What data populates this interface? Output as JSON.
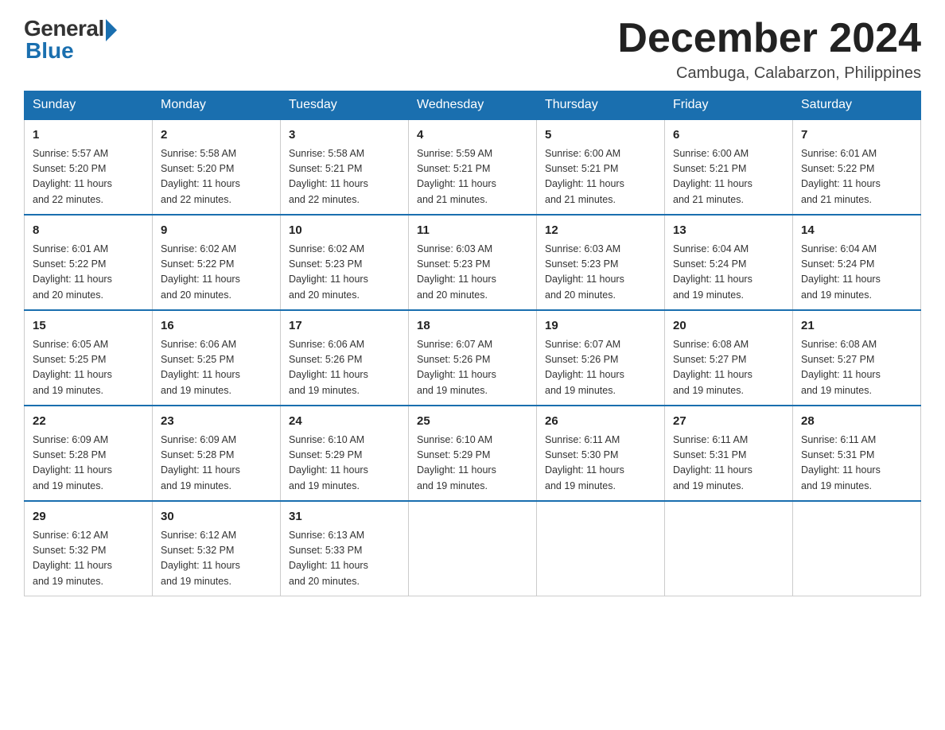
{
  "logo": {
    "general": "General",
    "blue": "Blue"
  },
  "title": "December 2024",
  "location": "Cambuga, Calabarzon, Philippines",
  "headers": [
    "Sunday",
    "Monday",
    "Tuesday",
    "Wednesday",
    "Thursday",
    "Friday",
    "Saturday"
  ],
  "weeks": [
    [
      {
        "day": "1",
        "info": "Sunrise: 5:57 AM\nSunset: 5:20 PM\nDaylight: 11 hours\nand 22 minutes."
      },
      {
        "day": "2",
        "info": "Sunrise: 5:58 AM\nSunset: 5:20 PM\nDaylight: 11 hours\nand 22 minutes."
      },
      {
        "day": "3",
        "info": "Sunrise: 5:58 AM\nSunset: 5:21 PM\nDaylight: 11 hours\nand 22 minutes."
      },
      {
        "day": "4",
        "info": "Sunrise: 5:59 AM\nSunset: 5:21 PM\nDaylight: 11 hours\nand 21 minutes."
      },
      {
        "day": "5",
        "info": "Sunrise: 6:00 AM\nSunset: 5:21 PM\nDaylight: 11 hours\nand 21 minutes."
      },
      {
        "day": "6",
        "info": "Sunrise: 6:00 AM\nSunset: 5:21 PM\nDaylight: 11 hours\nand 21 minutes."
      },
      {
        "day": "7",
        "info": "Sunrise: 6:01 AM\nSunset: 5:22 PM\nDaylight: 11 hours\nand 21 minutes."
      }
    ],
    [
      {
        "day": "8",
        "info": "Sunrise: 6:01 AM\nSunset: 5:22 PM\nDaylight: 11 hours\nand 20 minutes."
      },
      {
        "day": "9",
        "info": "Sunrise: 6:02 AM\nSunset: 5:22 PM\nDaylight: 11 hours\nand 20 minutes."
      },
      {
        "day": "10",
        "info": "Sunrise: 6:02 AM\nSunset: 5:23 PM\nDaylight: 11 hours\nand 20 minutes."
      },
      {
        "day": "11",
        "info": "Sunrise: 6:03 AM\nSunset: 5:23 PM\nDaylight: 11 hours\nand 20 minutes."
      },
      {
        "day": "12",
        "info": "Sunrise: 6:03 AM\nSunset: 5:23 PM\nDaylight: 11 hours\nand 20 minutes."
      },
      {
        "day": "13",
        "info": "Sunrise: 6:04 AM\nSunset: 5:24 PM\nDaylight: 11 hours\nand 19 minutes."
      },
      {
        "day": "14",
        "info": "Sunrise: 6:04 AM\nSunset: 5:24 PM\nDaylight: 11 hours\nand 19 minutes."
      }
    ],
    [
      {
        "day": "15",
        "info": "Sunrise: 6:05 AM\nSunset: 5:25 PM\nDaylight: 11 hours\nand 19 minutes."
      },
      {
        "day": "16",
        "info": "Sunrise: 6:06 AM\nSunset: 5:25 PM\nDaylight: 11 hours\nand 19 minutes."
      },
      {
        "day": "17",
        "info": "Sunrise: 6:06 AM\nSunset: 5:26 PM\nDaylight: 11 hours\nand 19 minutes."
      },
      {
        "day": "18",
        "info": "Sunrise: 6:07 AM\nSunset: 5:26 PM\nDaylight: 11 hours\nand 19 minutes."
      },
      {
        "day": "19",
        "info": "Sunrise: 6:07 AM\nSunset: 5:26 PM\nDaylight: 11 hours\nand 19 minutes."
      },
      {
        "day": "20",
        "info": "Sunrise: 6:08 AM\nSunset: 5:27 PM\nDaylight: 11 hours\nand 19 minutes."
      },
      {
        "day": "21",
        "info": "Sunrise: 6:08 AM\nSunset: 5:27 PM\nDaylight: 11 hours\nand 19 minutes."
      }
    ],
    [
      {
        "day": "22",
        "info": "Sunrise: 6:09 AM\nSunset: 5:28 PM\nDaylight: 11 hours\nand 19 minutes."
      },
      {
        "day": "23",
        "info": "Sunrise: 6:09 AM\nSunset: 5:28 PM\nDaylight: 11 hours\nand 19 minutes."
      },
      {
        "day": "24",
        "info": "Sunrise: 6:10 AM\nSunset: 5:29 PM\nDaylight: 11 hours\nand 19 minutes."
      },
      {
        "day": "25",
        "info": "Sunrise: 6:10 AM\nSunset: 5:29 PM\nDaylight: 11 hours\nand 19 minutes."
      },
      {
        "day": "26",
        "info": "Sunrise: 6:11 AM\nSunset: 5:30 PM\nDaylight: 11 hours\nand 19 minutes."
      },
      {
        "day": "27",
        "info": "Sunrise: 6:11 AM\nSunset: 5:31 PM\nDaylight: 11 hours\nand 19 minutes."
      },
      {
        "day": "28",
        "info": "Sunrise: 6:11 AM\nSunset: 5:31 PM\nDaylight: 11 hours\nand 19 minutes."
      }
    ],
    [
      {
        "day": "29",
        "info": "Sunrise: 6:12 AM\nSunset: 5:32 PM\nDaylight: 11 hours\nand 19 minutes."
      },
      {
        "day": "30",
        "info": "Sunrise: 6:12 AM\nSunset: 5:32 PM\nDaylight: 11 hours\nand 19 minutes."
      },
      {
        "day": "31",
        "info": "Sunrise: 6:13 AM\nSunset: 5:33 PM\nDaylight: 11 hours\nand 20 minutes."
      },
      {
        "day": "",
        "info": ""
      },
      {
        "day": "",
        "info": ""
      },
      {
        "day": "",
        "info": ""
      },
      {
        "day": "",
        "info": ""
      }
    ]
  ]
}
